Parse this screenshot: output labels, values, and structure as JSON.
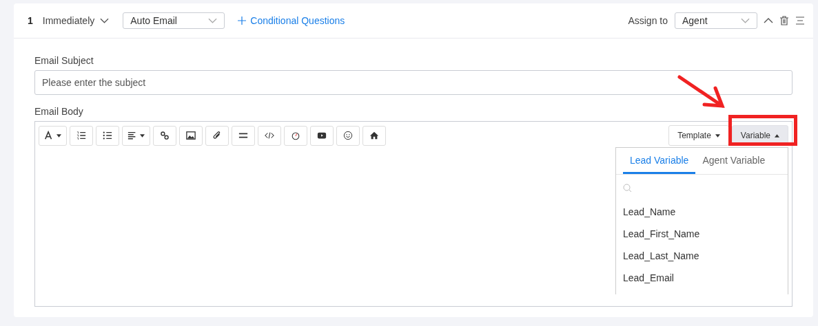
{
  "step": {
    "number": "1",
    "timing": "Immediately",
    "action": "Auto Email",
    "conditional_link": "Conditional Questions",
    "assign_label": "Assign to",
    "assignee": "Agent",
    "expanded": true
  },
  "subject": {
    "label": "Email Subject",
    "placeholder": "Please enter the subject"
  },
  "body": {
    "label": "Email Body",
    "toolbar": [
      {
        "kind": "font",
        "caret": true
      },
      {
        "kind": "ordered-list",
        "caret": false
      },
      {
        "kind": "bullet-list",
        "caret": false
      },
      {
        "kind": "align",
        "caret": true
      },
      {
        "kind": "link",
        "caret": false
      },
      {
        "kind": "image",
        "caret": false
      },
      {
        "kind": "attachment",
        "caret": false
      },
      {
        "kind": "rule",
        "caret": false
      },
      {
        "kind": "code",
        "caret": false
      },
      {
        "kind": "timer",
        "caret": false
      },
      {
        "kind": "video",
        "caret": false
      },
      {
        "kind": "emoji",
        "caret": false
      },
      {
        "kind": "home",
        "caret": false
      }
    ],
    "template_button": "Template",
    "variable_button": {
      "label": "Variable",
      "expanded": true
    }
  },
  "variable_menu": {
    "tabs": [
      {
        "label": "Lead Variable",
        "selected": true
      },
      {
        "label": "Agent Variable",
        "selected": false
      }
    ],
    "items": [
      "Lead_Name",
      "Lead_First_Name",
      "Lead_Last_Name",
      "Lead_Email"
    ]
  }
}
